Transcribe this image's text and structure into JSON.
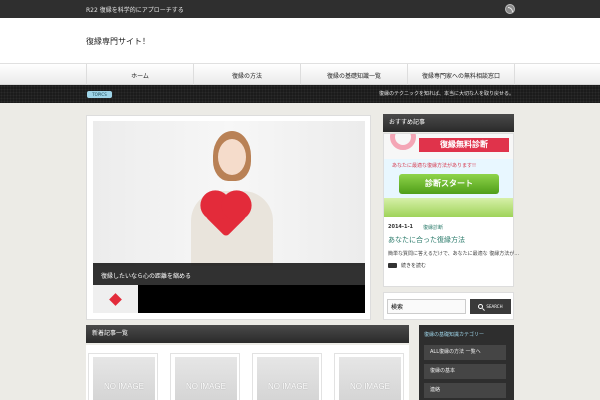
{
  "topbar": {
    "tagline": "R22 復縁を科学的にアプローチする"
  },
  "header": {
    "site_title": "復縁専門サイト！"
  },
  "nav": {
    "items": [
      "ホーム",
      "復縁の方法",
      "復縁の基礎知識一覧",
      "復縁専門家への無料相談窓口"
    ]
  },
  "topics": {
    "badge": "TOPICS",
    "headline": "復縁のテクニックを知れば、本当に大切な人を取り戻せる。"
  },
  "slider": {
    "caption": "復縁したいなら心の距離を縮める"
  },
  "latest": {
    "heading": "新着記事一覧",
    "no_image": "NO IMAGE"
  },
  "sidebar": {
    "recommended": {
      "heading": "おすすめ記事",
      "banner_title": "復縁無料診断",
      "banner_sub": "あなたに最適な復縁方法があります!!",
      "banner_button": "診断スタート",
      "date": "2014-1-1",
      "category": "復縁診断",
      "post_title": "あなたに合った復縁方法",
      "excerpt": "簡単な質問に答えるだけで、あなたに最適な 復縁方法が…",
      "more": "続きを読む"
    },
    "search": {
      "value": "検索",
      "button": "SEARCH"
    },
    "categories": {
      "heading": "復縁の基礎知識カテゴリー",
      "items": [
        "ALL復縁の方法 一覧へ",
        "復縁の基本",
        "連絡"
      ]
    }
  },
  "colors": {
    "accent_teal": "#2a7a6a",
    "badge_blue": "#9ed4e8",
    "banner_red": "#e0334b",
    "banner_green": "#4f9e18"
  }
}
